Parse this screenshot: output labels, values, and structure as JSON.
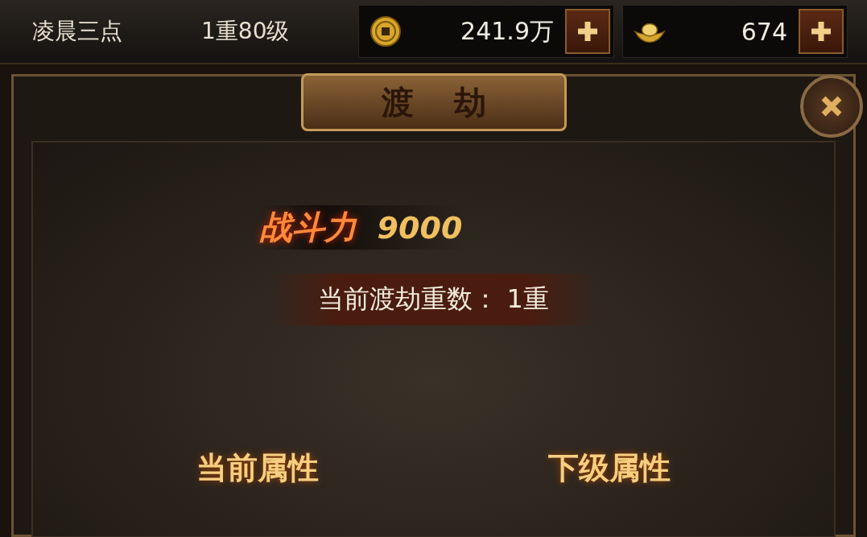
{
  "top_bar": {
    "player_name": "凌晨三点",
    "level": "1重80级",
    "currencies": [
      {
        "kind": "coin",
        "amount": "241.9万"
      },
      {
        "kind": "ingot",
        "amount": "674"
      }
    ]
  },
  "dialog": {
    "title": "渡劫",
    "power": {
      "label": "战斗力",
      "value": "9000"
    },
    "tribulation": "当前渡劫重数：  1重",
    "columns": [
      "当前属性",
      "下级属性"
    ]
  }
}
